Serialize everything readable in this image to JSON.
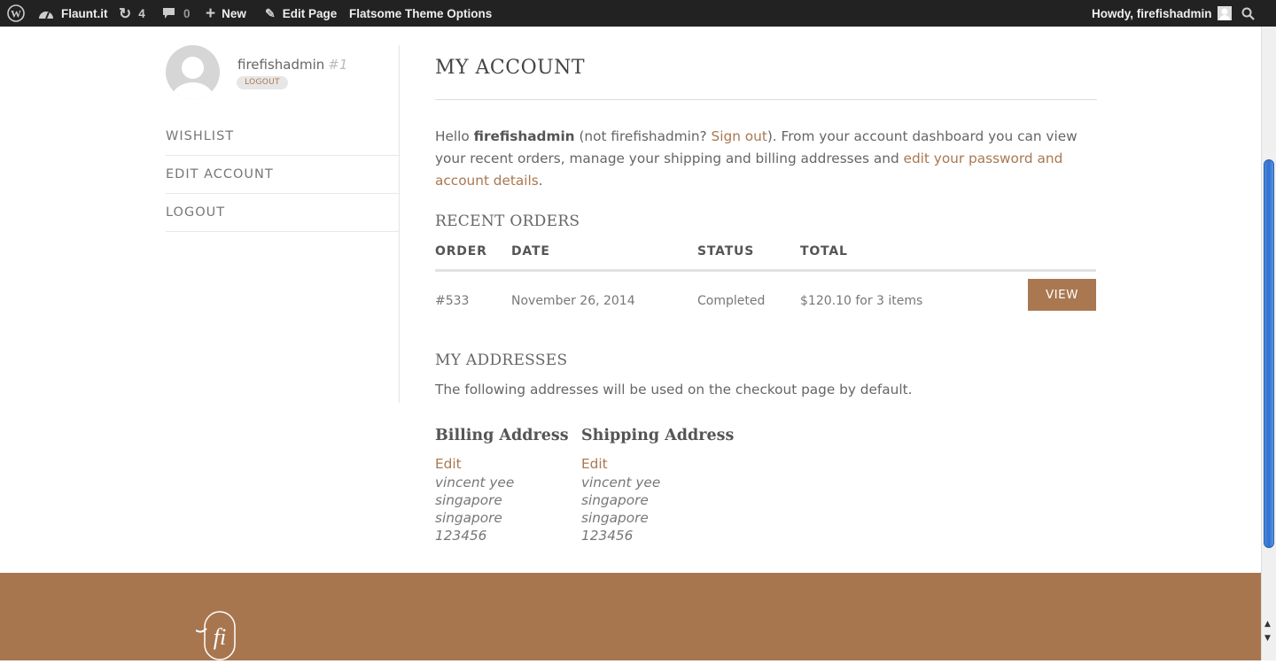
{
  "admin_bar": {
    "site_name": "Flaunt.it",
    "updates_count": "4",
    "comments_count": "0",
    "new_label": "New",
    "edit_page_label": "Edit Page",
    "theme_options_label": "Flatsome Theme Options",
    "greeting": "Howdy, firefishadmin"
  },
  "sidebar": {
    "username": "firefishadmin",
    "user_id": "#1",
    "logout_badge": "LOGOUT",
    "nav": [
      "WISHLIST",
      "EDIT ACCOUNT",
      "LOGOUT"
    ]
  },
  "main": {
    "title": "MY ACCOUNT",
    "intro": {
      "hello": "Hello ",
      "name": "firefishadmin",
      "not_prefix": " (not firefishadmin? ",
      "sign_out": "Sign out",
      "middle": "). From your account dashboard you can view your recent orders, manage your shipping and billing addresses and ",
      "edit_link": "edit your password and account details",
      "end": "."
    },
    "recent_orders": {
      "heading": "RECENT ORDERS",
      "columns": [
        "ORDER",
        "DATE",
        "STATUS",
        "TOTAL"
      ],
      "rows": [
        {
          "order": "#533",
          "date": "November 26, 2014",
          "status": "Completed",
          "total": "$120.10 for 3 items",
          "action": "VIEW"
        }
      ]
    },
    "addresses": {
      "heading": "MY ADDRESSES",
      "intro": "The following addresses will be used on the checkout page by default.",
      "billing": {
        "title": "Billing Address",
        "edit": "Edit",
        "lines": [
          "vincent yee",
          "singapore",
          "singapore",
          "123456"
        ]
      },
      "shipping": {
        "title": "Shipping Address",
        "edit": "Edit",
        "lines": [
          "vincent yee",
          "singapore",
          "singapore",
          "123456"
        ]
      }
    }
  },
  "footer": {
    "logo_text": "fi"
  },
  "colors": {
    "accent": "#a97850",
    "footer_bg": "#a8764e",
    "admin_bar": "#222222"
  }
}
